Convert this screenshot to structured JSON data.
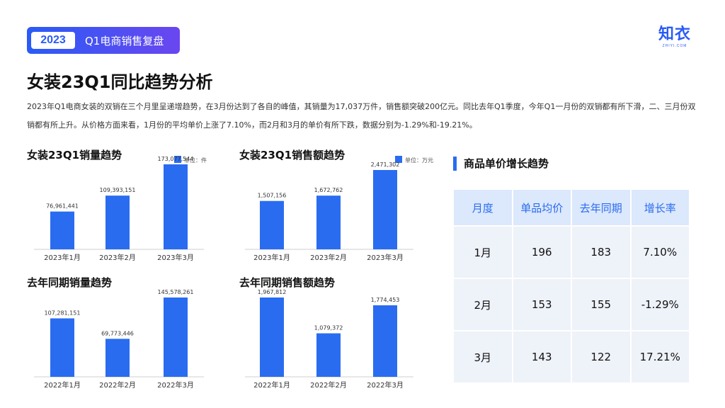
{
  "header": {
    "year": "2023",
    "title": "Q1电商销售复盘"
  },
  "logo": {
    "main": "知衣",
    "sub": "ZHIYI.COM"
  },
  "page_title": "女装23Q1同比趋势分析",
  "intro": "2023年Q1电商女装的双销在三个月里呈递增趋势，在3月份达到了各自的峰值，其销量为17,037万件，销售额突破200亿元。同比去年Q1季度，今年Q1一月份的双销都有所下滑，二、三月份双销都有所上升。从价格方面来看，1月份的平均单价上涨了7.10%，而2月和3月的单价有所下跌，数据分别为-1.29%和-19.21%。",
  "chart_data": [
    {
      "type": "bar",
      "title": "女装23Q1销量趋势",
      "unit": "单位：件",
      "categories": [
        "2023年1月",
        "2023年2月",
        "2023年3月"
      ],
      "values": [
        76961441,
        109393151,
        173077544
      ],
      "labels": [
        "76,961,441",
        "109,393,151",
        "173,077,544"
      ],
      "color": "#2a6cf0"
    },
    {
      "type": "bar",
      "title": "女装23Q1销售额趋势",
      "unit": "单位：万元",
      "categories": [
        "2023年1月",
        "2023年2月",
        "2023年3月"
      ],
      "values": [
        1507156,
        1672762,
        2471302
      ],
      "labels": [
        "1,507,156",
        "1,672,762",
        "2,471,302"
      ],
      "color": "#2a6cf0"
    },
    {
      "type": "bar",
      "title": "去年同期销量趋势",
      "unit": "",
      "categories": [
        "2022年1月",
        "2022年2月",
        "2022年3月"
      ],
      "values": [
        107281151,
        69773446,
        145578261
      ],
      "labels": [
        "107,281,151",
        "69,773,446",
        "145,578,261"
      ],
      "color": "#2a6cf0"
    },
    {
      "type": "bar",
      "title": "去年同期销售额趋势",
      "unit": "",
      "categories": [
        "2022年1月",
        "2022年2月",
        "2022年3月"
      ],
      "values": [
        1967812,
        1079372,
        1774453
      ],
      "labels": [
        "1,967,812",
        "1,079,372",
        "1,774,453"
      ],
      "color": "#2a6cf0"
    }
  ],
  "price_table": {
    "title": "商品单价增长趋势",
    "headers": [
      "月度",
      "单品均价",
      "去年同期",
      "增长率"
    ],
    "rows": [
      [
        "1月",
        "196",
        "183",
        "7.10%"
      ],
      [
        "2月",
        "153",
        "155",
        "-1.29%"
      ],
      [
        "3月",
        "143",
        "122",
        "17.21%"
      ]
    ]
  }
}
